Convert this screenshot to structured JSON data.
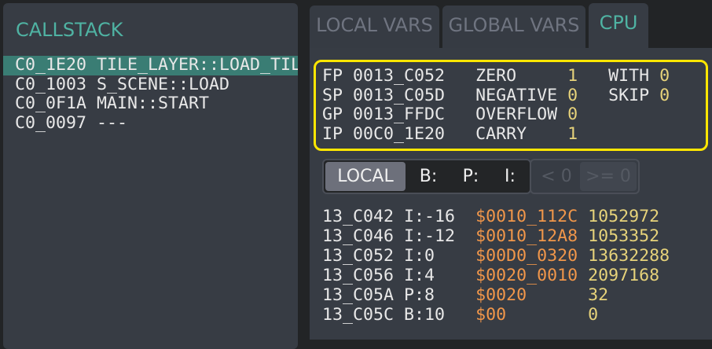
{
  "callstack": {
    "title": "CALLSTACK",
    "frames": [
      {
        "addr": "C0_1E20",
        "name": "TILE_LAYER::LOAD_TILES",
        "selected": true
      },
      {
        "addr": "C0_1003",
        "name": "S_SCENE::LOAD"
      },
      {
        "addr": "C0_0F1A",
        "name": "MAIN::START"
      },
      {
        "addr": "C0_0097",
        "name": "---"
      }
    ]
  },
  "tabs": [
    {
      "label": "LOCAL VARS"
    },
    {
      "label": "GLOBAL VARS"
    },
    {
      "label": "CPU",
      "active": true
    }
  ],
  "cpu": {
    "registers": [
      {
        "name": "FP",
        "value": "0013_C052"
      },
      {
        "name": "SP",
        "value": "0013_C05D"
      },
      {
        "name": "GP",
        "value": "0013_FFDC"
      },
      {
        "name": "IP",
        "value": "00C0_1E20"
      }
    ],
    "flags": [
      {
        "name": "ZERO",
        "value": "1"
      },
      {
        "name": "NEGATIVE",
        "value": "0"
      },
      {
        "name": "OVERFLOW",
        "value": "0"
      },
      {
        "name": "CARRY",
        "value": "1"
      }
    ],
    "modes": [
      {
        "name": "WITH",
        "value": "0"
      },
      {
        "name": "SKIP",
        "value": "0"
      }
    ]
  },
  "filters": {
    "scope": [
      {
        "label": "LOCAL",
        "active": true
      },
      {
        "label": "B:"
      },
      {
        "label": "P:"
      },
      {
        "label": "I:"
      }
    ],
    "sign": [
      {
        "label": "< 0"
      },
      {
        "label": ">= 0"
      }
    ]
  },
  "colors": {
    "accent": "#4fb3a3",
    "highlight": "#3a7d74",
    "number": "#e6d27a",
    "hex": "#f0964a",
    "focus_border": "#ffe600"
  },
  "vars": [
    {
      "addr": "13_C042",
      "offset": "I:-16",
      "hex": "$0010_112C",
      "dec": "1052972"
    },
    {
      "addr": "13_C046",
      "offset": "I:-12",
      "hex": "$0010_12A8",
      "dec": "1053352"
    },
    {
      "addr": "13_C052",
      "offset": "I:0",
      "hex": "$00D0_0320",
      "dec": "13632288"
    },
    {
      "addr": "13_C056",
      "offset": "I:4",
      "hex": "$0020_0010",
      "dec": "2097168"
    },
    {
      "addr": "13_C05A",
      "offset": "P:8",
      "hex": "$0020",
      "dec": "32"
    },
    {
      "addr": "13_C05C",
      "offset": "B:10",
      "hex": "$00",
      "dec": "0"
    }
  ]
}
